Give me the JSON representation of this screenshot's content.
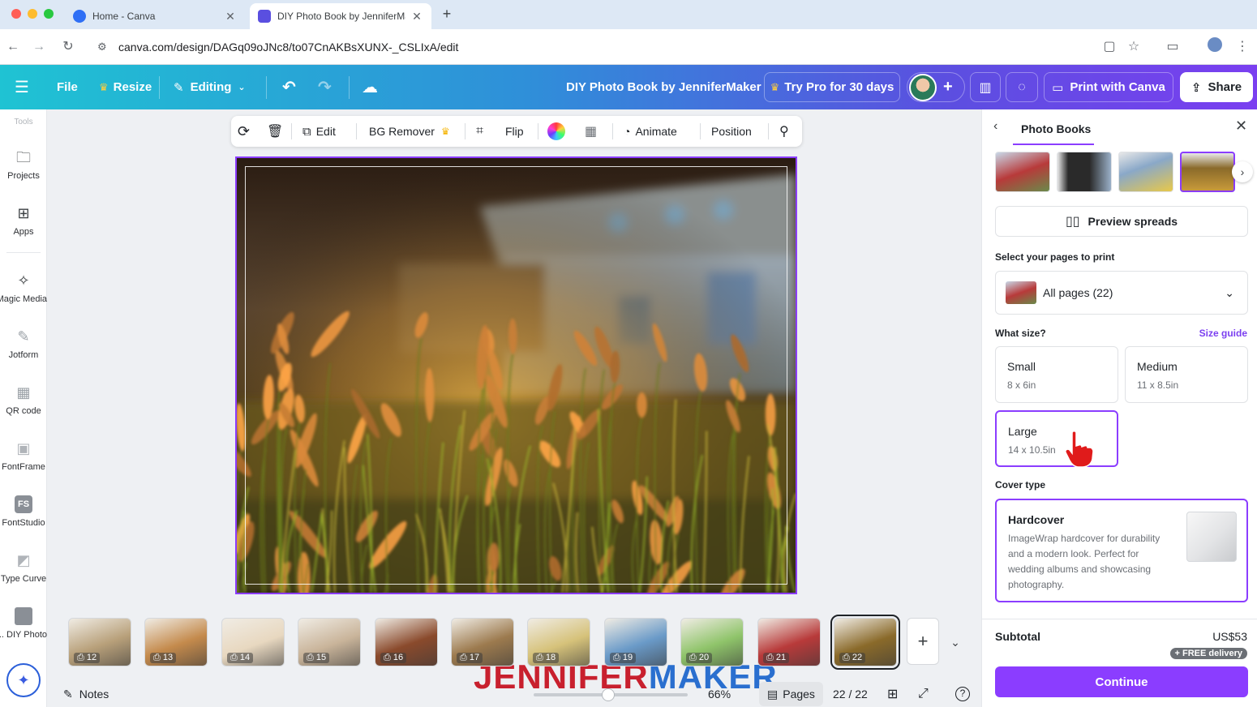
{
  "browser": {
    "tabs": [
      {
        "title": "Home - Canva",
        "favicon_color": "#2f6ff5"
      },
      {
        "title": "DIY Photo Book by JenniferMaker",
        "favicon_color": "#5a4fe0"
      }
    ],
    "url": "canva.com/design/DAGq09oJNc8/to07CnAKBsXUNX-_CSLIxA/edit"
  },
  "toolbar": {
    "file": "File",
    "resize": "Resize",
    "editing": "Editing",
    "doc_title": "DIY Photo Book by JenniferMaker",
    "try_pro": "Try Pro for 30 days",
    "print": "Print with Canva",
    "share": "Share"
  },
  "left_rail": {
    "tools_label": "Tools",
    "items": [
      {
        "label": "Projects",
        "icon": "folder-icon"
      },
      {
        "label": "Apps",
        "icon": "apps-icon"
      },
      {
        "label": "Magic Media",
        "icon": "magic-media-icon"
      },
      {
        "label": "Jotform",
        "icon": "jotform-icon"
      },
      {
        "label": "QR code",
        "icon": "qr-code-icon"
      },
      {
        "label": "FontFrame",
        "icon": "fontframe-icon"
      },
      {
        "label": "FontStudio",
        "icon": "fontstudio-icon"
      },
      {
        "label": "Type Curve",
        "icon": "type-curve-icon"
      },
      {
        "label": "DIY Photo ...",
        "icon": "diy-photo-icon"
      }
    ]
  },
  "context_toolbar": {
    "edit": "Edit",
    "bg_remover": "BG Remover",
    "flip": "Flip",
    "animate": "Animate",
    "position": "Position"
  },
  "pages": {
    "thumbs": [
      {
        "num": "12",
        "bg": "#b8a07a"
      },
      {
        "num": "13",
        "bg": "#c48a4c"
      },
      {
        "num": "14",
        "bg": "#e8d8c0"
      },
      {
        "num": "15",
        "bg": "#c9b49a"
      },
      {
        "num": "16",
        "bg": "#8a4a2c"
      },
      {
        "num": "17",
        "bg": "#9c7a4e"
      },
      {
        "num": "18",
        "bg": "#d6c27a"
      },
      {
        "num": "19",
        "bg": "#6a9ac8"
      },
      {
        "num": "20",
        "bg": "#8fc46a"
      },
      {
        "num": "21",
        "bg": "#b83a3a"
      },
      {
        "num": "22",
        "bg": "#8a6a2a"
      }
    ],
    "current": "22 / 22"
  },
  "footer": {
    "notes": "Notes",
    "zoom": "66%",
    "pages": "Pages",
    "page_count": "22 / 22",
    "watermark_a": "JENNIFER",
    "watermark_b": "MAKER"
  },
  "panel": {
    "title": "Photo Books",
    "preview": "Preview spreads",
    "select_pages_label": "Select your pages to print",
    "select_pages_value": "All pages (22)",
    "size_label": "What size?",
    "size_guide": "Size guide",
    "sizes": [
      {
        "name": "Small",
        "dim": "8 x 6in"
      },
      {
        "name": "Medium",
        "dim": "11 x 8.5in"
      },
      {
        "name": "Large",
        "dim": "14 x 10.5in"
      }
    ],
    "cover_label": "Cover type",
    "cover_name": "Hardcover",
    "cover_desc": "ImageWrap hardcover for durability and a modern look. Perfect for wedding albums and showcasing photography.",
    "subtotal_label": "Subtotal",
    "subtotal_value": "US$53",
    "free_delivery": "+ FREE delivery",
    "continue": "Continue"
  },
  "colors": {
    "accent": "#8b3dff",
    "watermark_red": "#c8202e",
    "watermark_blue": "#2a6fcf"
  }
}
